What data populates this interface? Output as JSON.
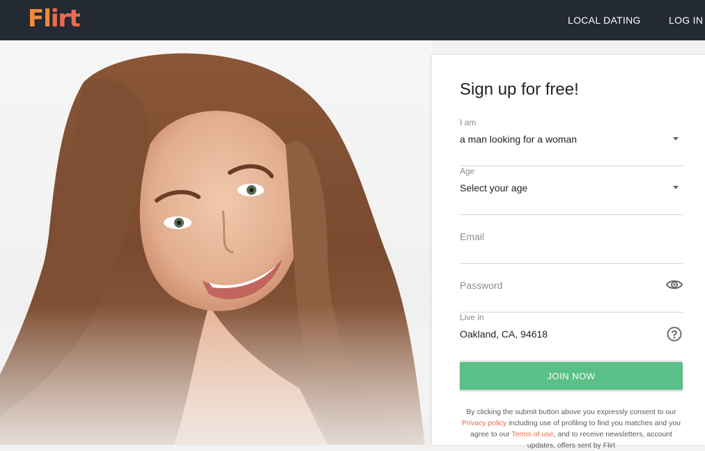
{
  "header": {
    "logo_text_a": "Fl",
    "logo_text_b": "irt",
    "nav_local": "LOCAL DATING",
    "nav_login": "LOG IN"
  },
  "form": {
    "title": "Sign up for free!",
    "iam": {
      "label": "I am",
      "value": "a man looking for a woman"
    },
    "age": {
      "label": "Age",
      "value": "Select your age"
    },
    "email": {
      "placeholder": "Email"
    },
    "password": {
      "placeholder": "Password"
    },
    "live": {
      "label": "Live in",
      "value": "Oakland, CA, 94618"
    },
    "join_label": "JOIN NOW",
    "consent": {
      "part1": "By clicking the submit button above you expressly consent to our ",
      "privacy_link": "Privacy policy",
      "part2": " including use of profiling to find you matches and you agree to our ",
      "terms_link": "Terms of use",
      "part3": ", and to receive newsletters, account updates, offers sent by Flirt"
    }
  },
  "colors": {
    "topbar": "#232a33",
    "accent_green": "#5bbf88",
    "link_orange": "#e8684a",
    "logo_orange": "#f08a3a"
  }
}
